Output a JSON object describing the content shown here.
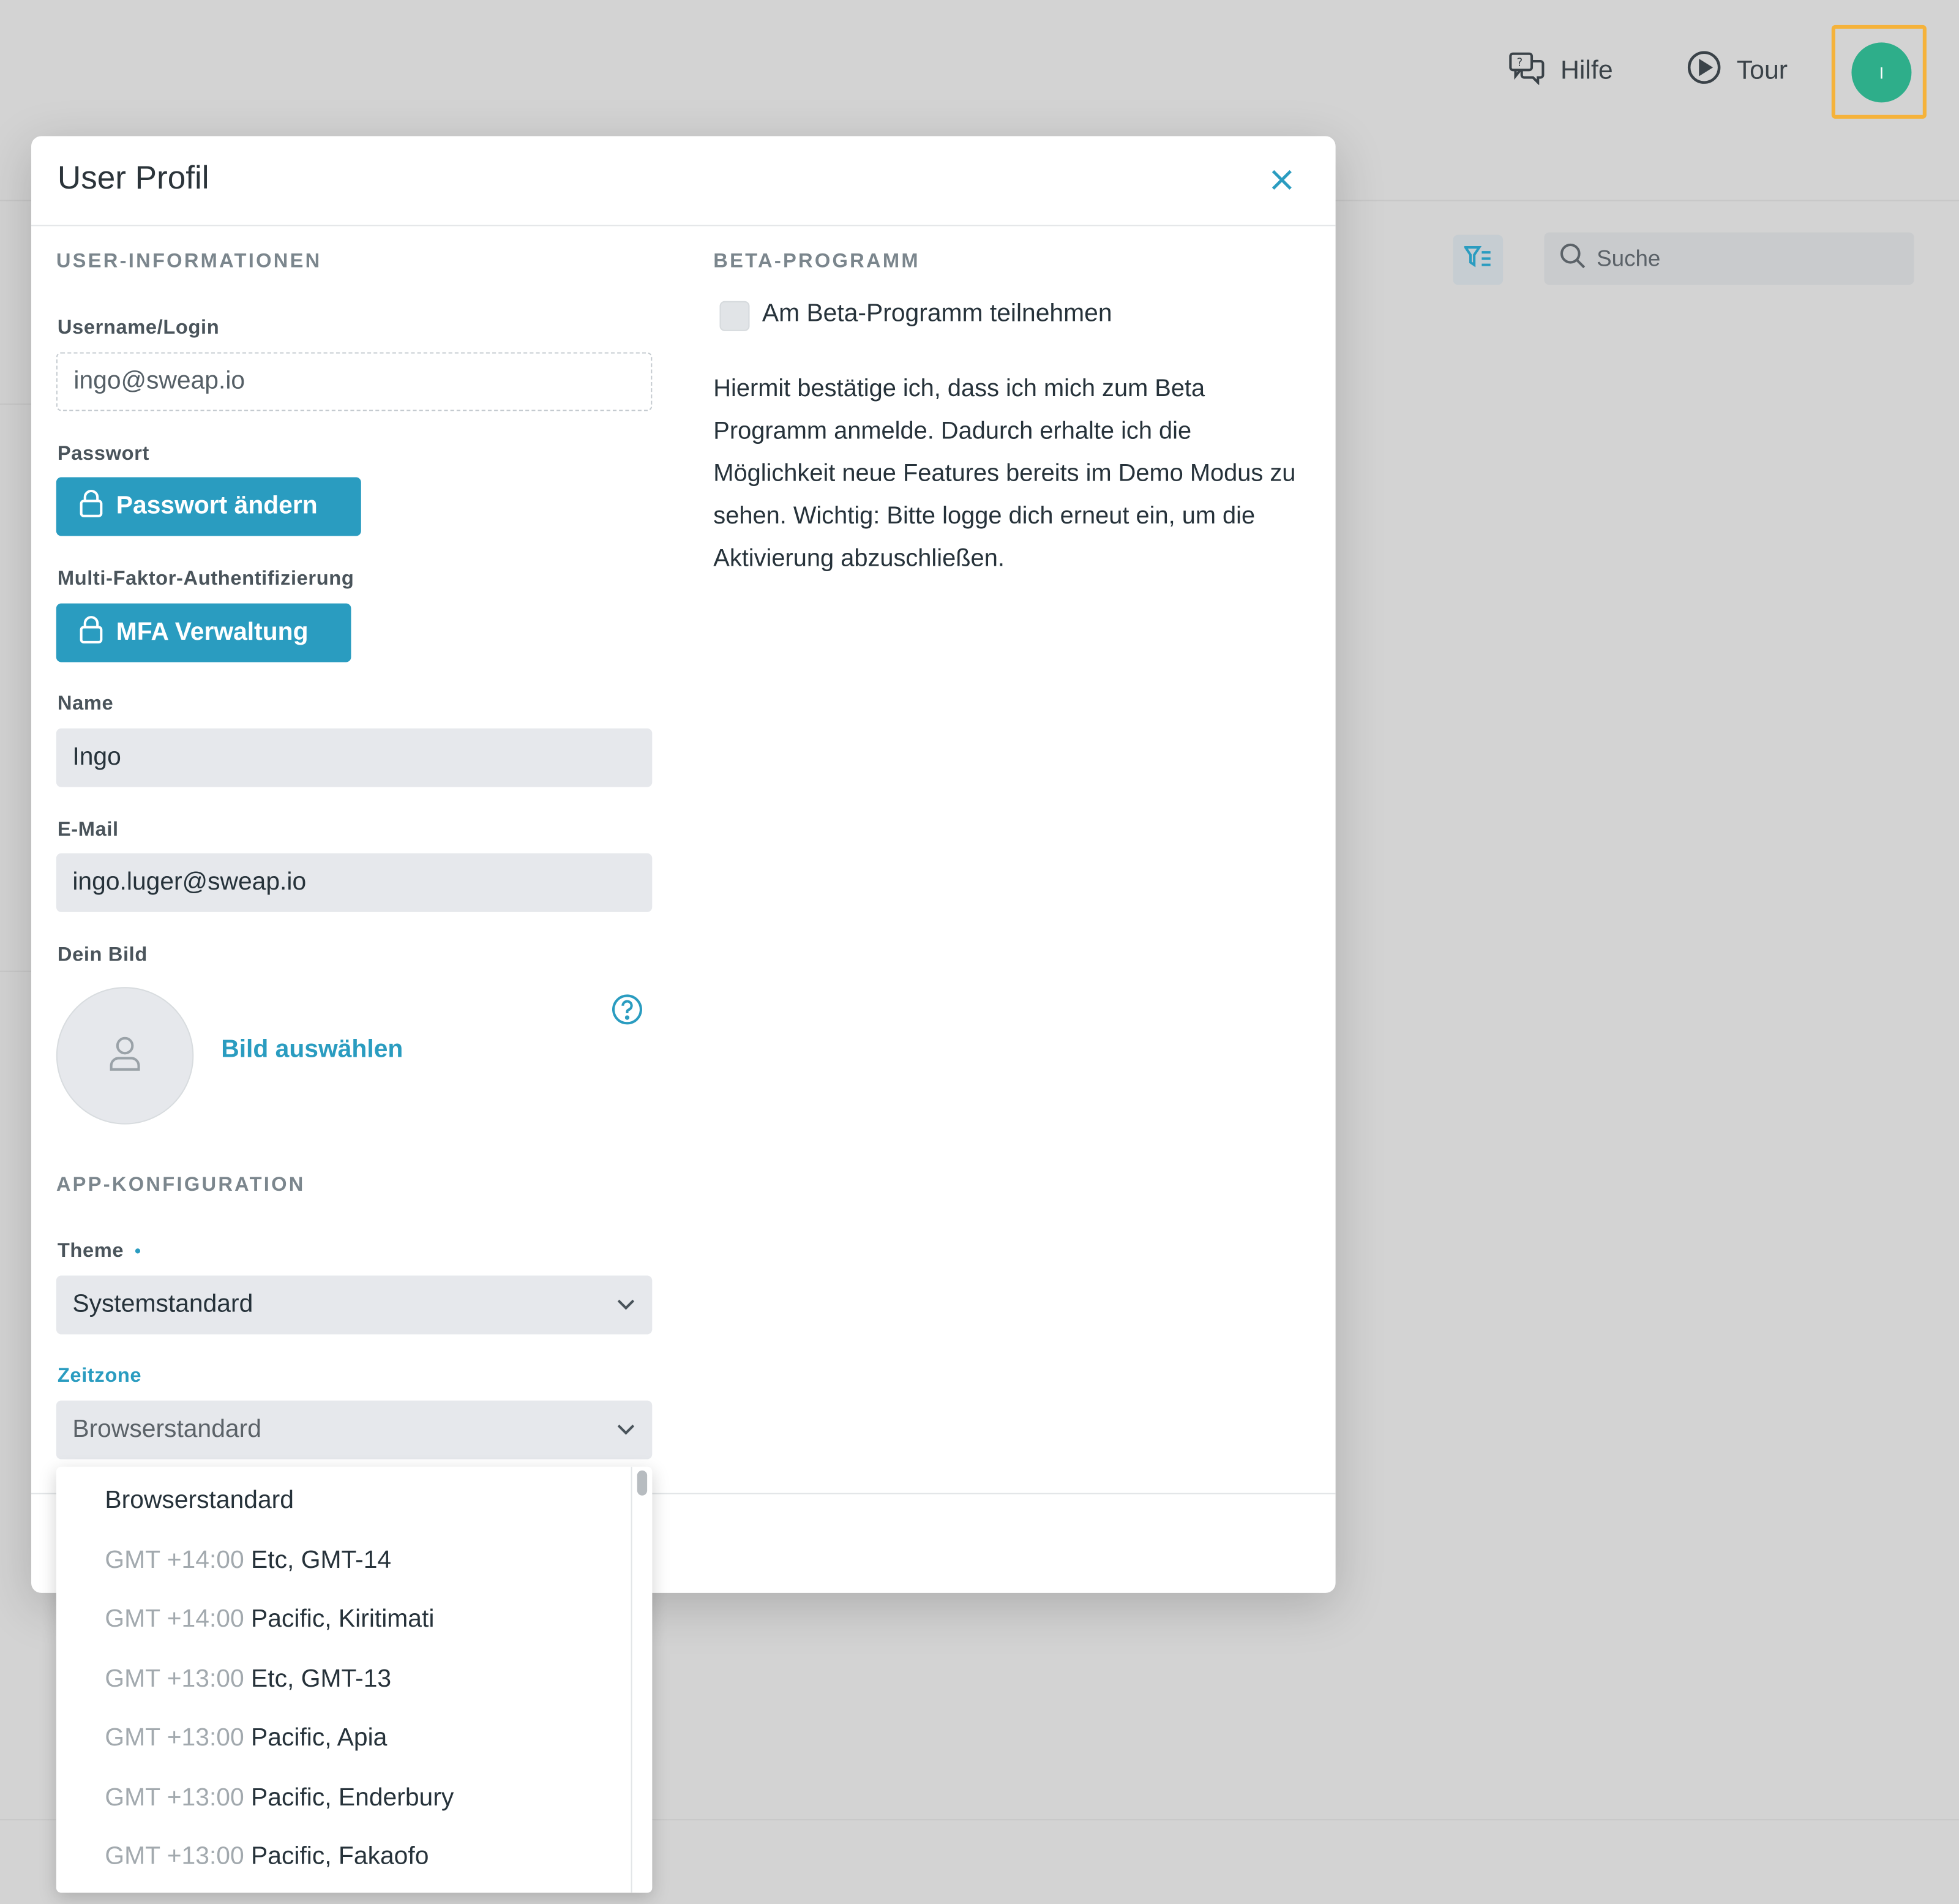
{
  "topbar": {
    "help_label": "Hilfe",
    "tour_label": "Tour",
    "avatar_initial": "I",
    "search_placeholder": "Suche"
  },
  "modal": {
    "title": "User Profil",
    "user_info": {
      "section_title": "USER-INFORMATIONEN",
      "username_label": "Username/Login",
      "username_value": "ingo@sweap.io",
      "password_label": "Passwort",
      "password_button": "Passwort ändern",
      "mfa_label": "Multi-Faktor-Authentifizierung",
      "mfa_button": "MFA Verwaltung",
      "name_label": "Name",
      "name_value": "Ingo",
      "email_label": "E-Mail",
      "email_value": "ingo.luger@sweap.io",
      "picture_label": "Dein Bild",
      "picture_link": "Bild auswählen"
    },
    "app_config": {
      "section_title": "APP-KONFIGURATION",
      "theme_label": "Theme",
      "theme_required_mark": "•",
      "theme_value": "Systemstandard",
      "timezone_label": "Zeitzone",
      "timezone_value": "Browserstandard"
    },
    "beta": {
      "section_title": "BETA-PROGRAMM",
      "checkbox_label": "Am Beta-Programm teilnehmen",
      "description": "Hiermit bestätige ich, dass ich mich zum Beta Programm anmelde. Dadurch erhalte ich die Möglichkeit neue Features bereits im Demo Modus zu sehen. Wichtig: Bitte logge dich erneut ein, um die Aktivierung abzuschließen."
    }
  },
  "timezone_dropdown": {
    "options": [
      {
        "gmt": "",
        "name": "Browserstandard"
      },
      {
        "gmt": "GMT +14:00",
        "name": "Etc, GMT-14"
      },
      {
        "gmt": "GMT +14:00",
        "name": "Pacific, Kiritimati"
      },
      {
        "gmt": "GMT +13:00",
        "name": "Etc, GMT-13"
      },
      {
        "gmt": "GMT +13:00",
        "name": "Pacific, Apia"
      },
      {
        "gmt": "GMT +13:00",
        "name": "Pacific, Enderbury"
      },
      {
        "gmt": "GMT +13:00",
        "name": "Pacific, Fakaofo"
      }
    ]
  },
  "colors": {
    "accent": "#2a9cc0",
    "avatar": "#2eae8a",
    "highlight": "#f5b23a"
  }
}
